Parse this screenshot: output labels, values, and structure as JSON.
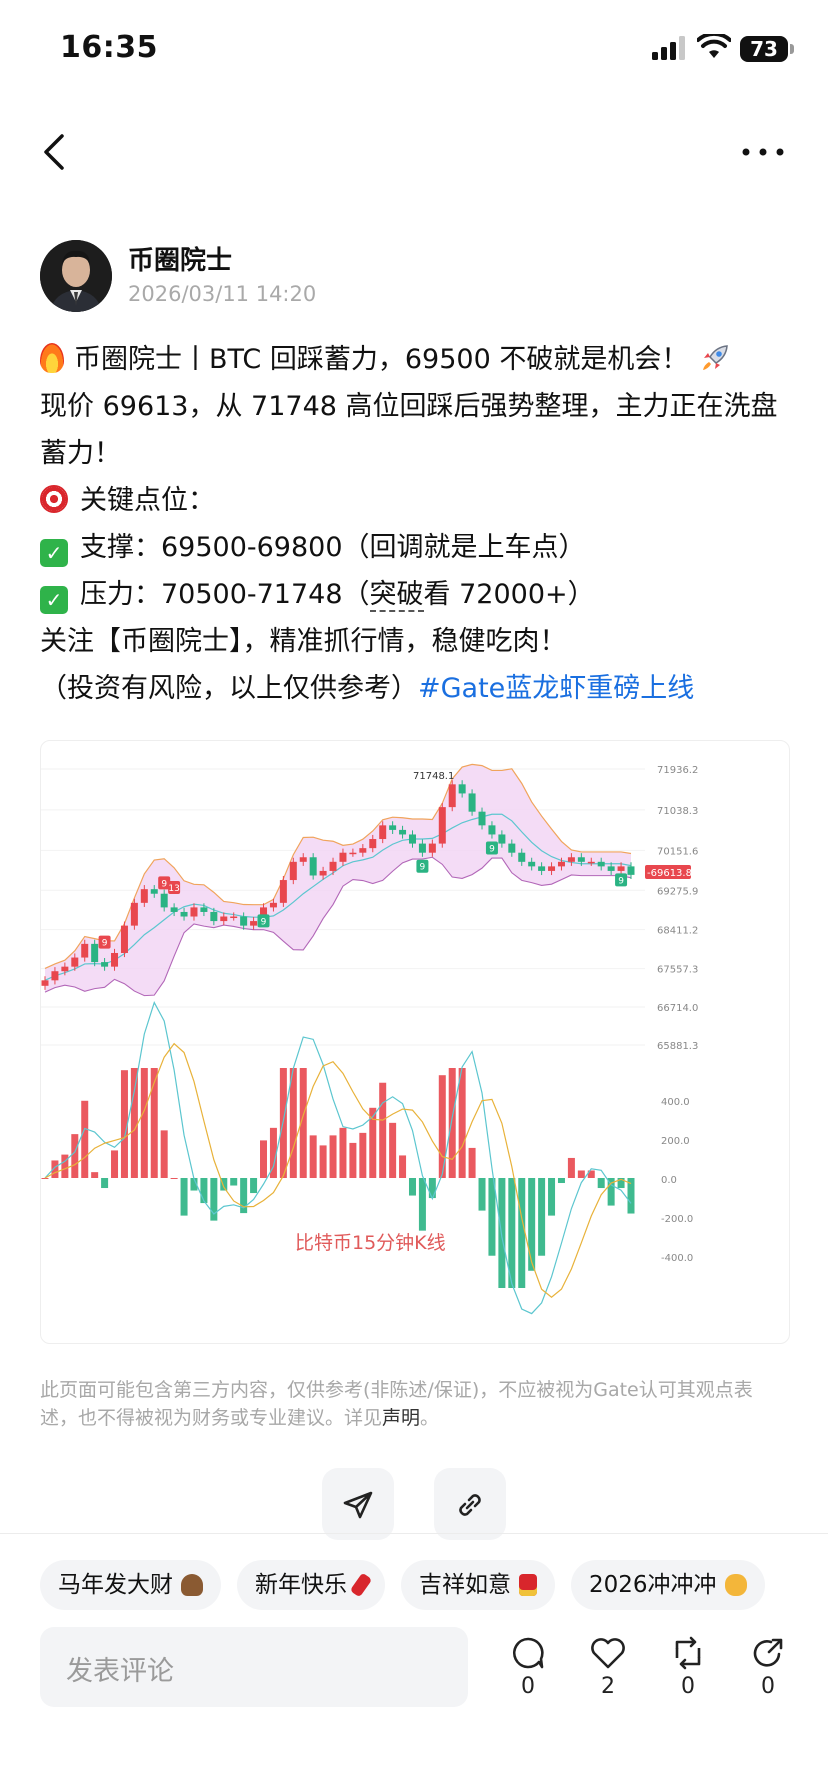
{
  "status_bar": {
    "time": "16:35",
    "battery": "73"
  },
  "author": {
    "name": "币圈院士",
    "time": "2026/03/11 14:20"
  },
  "post": {
    "line1": "币圈院士丨BTC 回踩蓄力，69500 不破就是机会！",
    "line2": "现价 69613，从 71748 高位回踩后强势整理，主力正在洗盘蓄力！",
    "line3": "关键点位：",
    "line4": "支撑：69500-69800（回调就是上车点）",
    "line5_a": "压力：70500-71748（",
    "line5_b": "突破",
    "line5_c": "看 72000+）",
    "line6": "关注【币圈院士】，精准抓行情，稳健吃肉！",
    "line7": "（投资有风险，以上仅供参考）",
    "hashtag": "#Gate蓝龙虾重磅上线"
  },
  "chart_data": {
    "type": "line",
    "title": "比特币15分钟K线",
    "price_axis_ticks": [
      71936.2,
      71038.3,
      70151.6,
      69275.9,
      68411.2,
      67557.3,
      66714.0,
      65881.3
    ],
    "price_axis_labels": [
      "71936.2",
      "71038.3",
      "70151.6",
      "69275.9",
      "68411.2",
      "67557.3",
      "66714.0",
      "65881.3"
    ],
    "current_price_label": "-69613.8",
    "high_annotation": "71748.1",
    "macd_axis_labels": [
      "400.0",
      "200.0",
      "0.0",
      "-200.0",
      "-400.0"
    ],
    "close_prices": [
      67300,
      67500,
      67600,
      67800,
      68100,
      67700,
      67600,
      67900,
      68500,
      69000,
      69300,
      69200,
      68900,
      68800,
      68700,
      68900,
      68800,
      68600,
      68700,
      68700,
      68500,
      68600,
      68900,
      69000,
      69500,
      69900,
      70000,
      69600,
      69700,
      69900,
      70100,
      70100,
      70200,
      70400,
      70700,
      70600,
      70500,
      70300,
      70100,
      70300,
      71100,
      71600,
      71400,
      71000,
      70700,
      70500,
      70300,
      70100,
      69900,
      69800,
      69700,
      69800,
      69900,
      70000,
      69900,
      69900,
      69800,
      69700,
      69800,
      69613.8
    ],
    "markers": [
      "9",
      "9",
      "13",
      "9",
      "9",
      "9",
      "9"
    ],
    "colors": {
      "up": "#e8474e",
      "down": "#2ab383",
      "band_fill": "#f2d6f5",
      "upper_band": "#f0a45c",
      "mid_line": "#5cc6cf",
      "hashtag": "#1a6fe0"
    }
  },
  "disclaimer": {
    "text": "此页面可能包含第三方内容，仅供参考(非陈述/保证)，不应被视为Gate认可其观点表述，也不得被视为财务或专业建议。详见",
    "link": "声明",
    "end": "。"
  },
  "chips": [
    {
      "label": "马年发大财",
      "icon": "horse-icon"
    },
    {
      "label": "新年快乐",
      "icon": "firecracker-icon"
    },
    {
      "label": "吉祥如意",
      "icon": "red-envelope-icon"
    },
    {
      "label": "2026冲冲冲",
      "icon": "fist-icon"
    }
  ],
  "bottom_bar": {
    "comment_placeholder": "发表评论",
    "comments": "0",
    "likes": "2",
    "reposts": "0",
    "shares": "0"
  }
}
